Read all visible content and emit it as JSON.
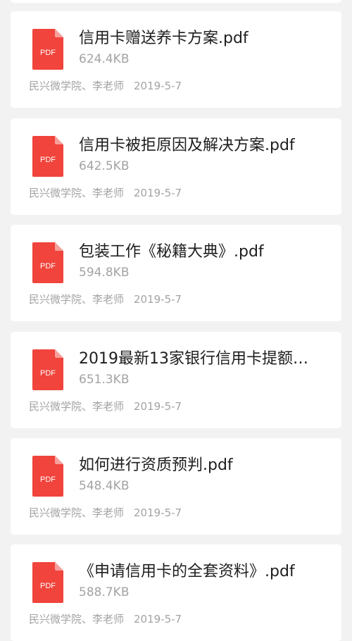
{
  "files": [
    {
      "title": "信用卡赠送养卡方案.pdf",
      "size": "624.4KB",
      "author": "民兴微学院、李老师",
      "date": "2019-5-7",
      "icon": "pdf-file-icon",
      "icon_label": "PDF"
    },
    {
      "title": "信用卡被拒原因及解决方案.pdf",
      "size": "642.5KB",
      "author": "民兴微学院、李老师",
      "date": "2019-5-7",
      "icon": "pdf-file-icon",
      "icon_label": "PDF"
    },
    {
      "title": "包装工作《秘籍大典》.pdf",
      "size": "594.8KB",
      "author": "民兴微学院、李老师",
      "date": "2019-5-7",
      "icon": "pdf-file-icon",
      "icon_label": "PDF"
    },
    {
      "title": "2019最新13家银行信用卡提额…",
      "size": "651.3KB",
      "author": "民兴微学院、李老师",
      "date": "2019-5-7",
      "icon": "pdf-file-icon",
      "icon_label": "PDF"
    },
    {
      "title": "如何进行资质预判.pdf",
      "size": "548.4KB",
      "author": "民兴微学院、李老师",
      "date": "2019-5-7",
      "icon": "pdf-file-icon",
      "icon_label": "PDF"
    },
    {
      "title": "《申请信用卡的全套资料》.pdf",
      "size": "588.7KB",
      "author": "民兴微学院、李老师",
      "date": "2019-5-7",
      "icon": "pdf-file-icon",
      "icon_label": "PDF"
    }
  ],
  "colors": {
    "background": "#f2f2f2",
    "card": "#ffffff",
    "pdf_red": "#f0443c",
    "pdf_fold": "#f7a09b",
    "title_text": "#1e1e1e",
    "secondary_text": "#a3a3a3"
  }
}
